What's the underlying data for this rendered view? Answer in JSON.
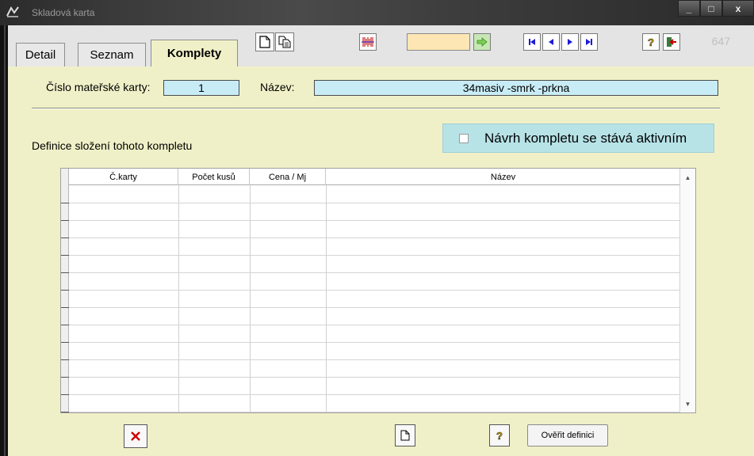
{
  "window": {
    "title": "Skladová karta",
    "minimize": "_",
    "maximize": "□",
    "close": "x"
  },
  "header": {
    "record_count": "647"
  },
  "tabs": [
    {
      "label": "Detail",
      "active": false
    },
    {
      "label": "Seznam",
      "active": false
    },
    {
      "label": "Komplety",
      "active": true
    }
  ],
  "toolbar": {
    "icons": [
      "new-document-icon",
      "copy-document-icon",
      "barcode-icon",
      "go-arrow-icon",
      "first-record-icon",
      "previous-record-icon",
      "next-record-icon",
      "last-record-icon",
      "help-icon",
      "exit-icon"
    ],
    "code_value": ""
  },
  "form": {
    "parent_card_label": "Číslo mateřské karty:",
    "parent_card_value": "1",
    "name_label": "Název:",
    "name_value": "34masiv -smrk -prkna"
  },
  "kit": {
    "definition_label": "Definice složení tohoto kompletu",
    "active_checkbox_label": "Návrh kompletu se stává aktivním",
    "active_checked": false
  },
  "table": {
    "columns": [
      "Č.karty",
      "Počet kusů",
      "Cena / Mj",
      "Název"
    ],
    "rows": []
  },
  "actions": {
    "delete_icon": "delete-x-icon",
    "new_icon": "new-document-icon",
    "help_icon": "help-icon",
    "verify_label": "Ověřit definici"
  },
  "colors": {
    "panel_bg": "#f0f0c8",
    "field_bg": "#c8ecf6",
    "code_input_bg": "#fde6b4",
    "nav_blue": "#1b1bd8",
    "delete_red": "#cc0000"
  }
}
